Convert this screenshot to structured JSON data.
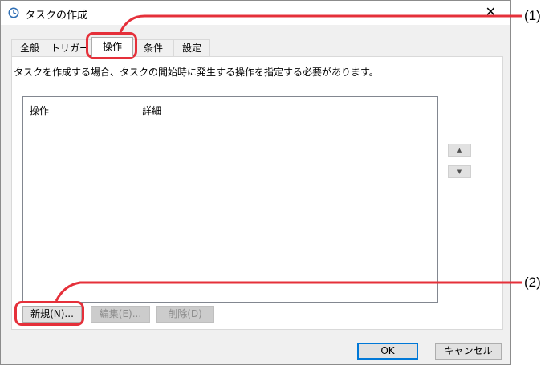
{
  "window": {
    "title": "タスクの作成",
    "close_glyph": "✕"
  },
  "tabs": [
    {
      "label": "全般"
    },
    {
      "label": "トリガー"
    },
    {
      "label": "操作"
    },
    {
      "label": "条件"
    },
    {
      "label": "設定"
    }
  ],
  "actions_tab": {
    "description": "タスクを作成する場合、タスクの開始時に発生する操作を指定する必要があります。",
    "columns": [
      "操作",
      "詳細"
    ],
    "move_up_glyph": "▲",
    "move_down_glyph": "▼",
    "new_button": "新規(N)...",
    "edit_button": "編集(E)...",
    "delete_button": "削除(D)"
  },
  "footer": {
    "ok_button": "OK",
    "cancel_button": "キャンセル"
  },
  "callouts": {
    "label_1": "(1)",
    "label_2": "(2)",
    "color": "#e5303a"
  },
  "active_tab_index": 2
}
